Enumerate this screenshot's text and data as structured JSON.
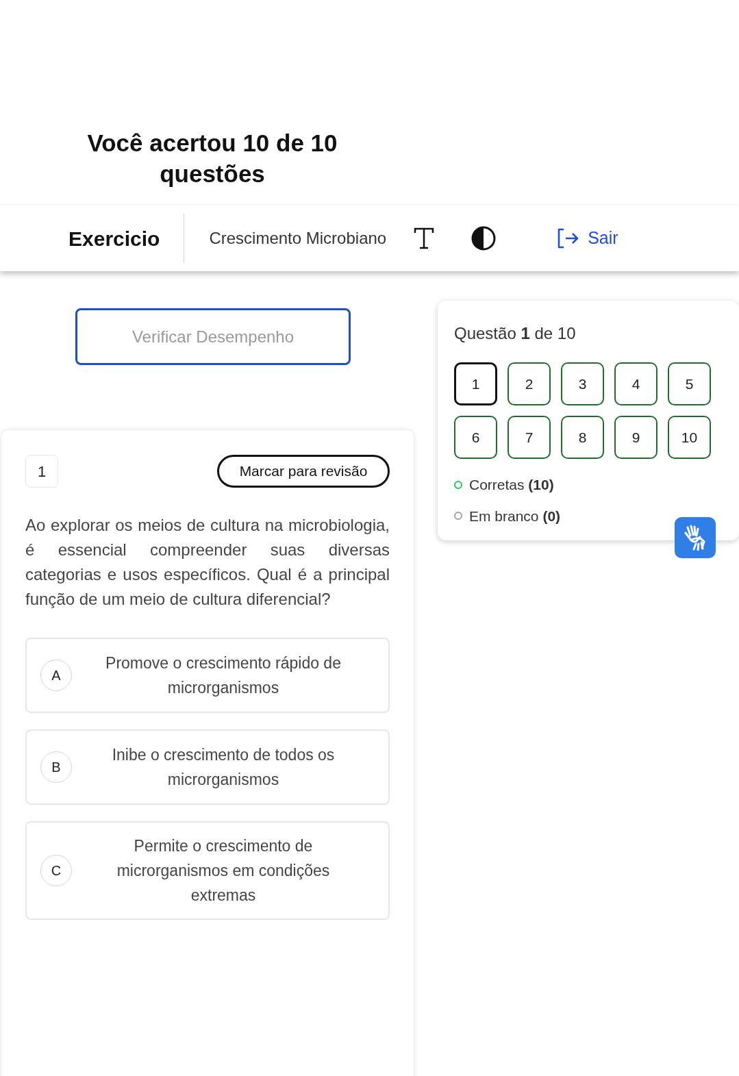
{
  "result_title": "Você acertou 10 de 10 questões",
  "header": {
    "title": "Exercicio",
    "subject": "Crescimento Microbiano",
    "exit_label": "Sair"
  },
  "verify_button": "Verificar Desempenho",
  "question": {
    "number": "1",
    "review_button": "Marcar para revisão",
    "text": "Ao explorar os meios de cultura na microbiologia, é essencial compreender suas diversas categorias e usos específicos. Qual é a principal função de um meio de cultura diferencial?",
    "options": [
      {
        "letter": "A",
        "text": "Promove o crescimento rápido de microrganismos"
      },
      {
        "letter": "B",
        "text": "Inibe o crescimento de todos os microrganismos"
      },
      {
        "letter": "C",
        "text": "Permite o crescimento de microrganismos em condições extremas"
      }
    ]
  },
  "navigator": {
    "title": "Questão **1** de 10",
    "items": [
      {
        "label": "1",
        "selected": true
      },
      {
        "label": "2",
        "selected": false
      },
      {
        "label": "3",
        "selected": false
      },
      {
        "label": "4",
        "selected": false
      },
      {
        "label": "5",
        "selected": false
      },
      {
        "label": "6",
        "selected": false
      },
      {
        "label": "7",
        "selected": false
      },
      {
        "label": "8",
        "selected": false
      },
      {
        "label": "9",
        "selected": false
      },
      {
        "label": "10",
        "selected": false
      }
    ],
    "legend": [
      {
        "text": "Corretas **(10)**",
        "color": "#22c55e"
      },
      {
        "text": "Em branco **(0)**",
        "color": "#9ca3af"
      }
    ]
  }
}
